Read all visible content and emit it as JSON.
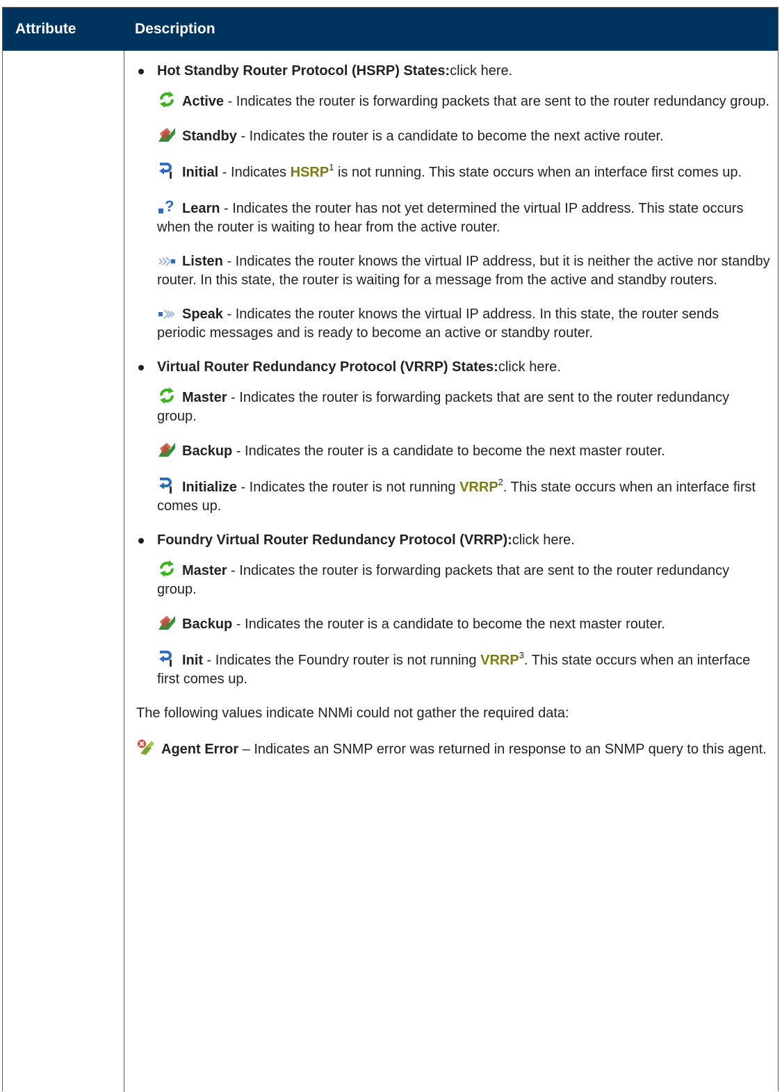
{
  "header": {
    "col_attribute": "Attribute",
    "col_description": "Description"
  },
  "groups": [
    {
      "title": "Hot Standby Router Protocol (HSRP) States:",
      "suffix": "click here.",
      "states": [
        {
          "icon": "active-cycle-icon",
          "name": "Active",
          "text": " - Indicates the router is forwarding packets that are sent to the router redundancy group."
        },
        {
          "icon": "standby-icon",
          "name": "Standby",
          "text": " - Indicates the router is a candidate to become the next active router."
        },
        {
          "icon": "initial-icon",
          "name": "Initial",
          "pre": " - Indicates ",
          "link": "HSRP",
          "sup": "1",
          "post": " is not running. This state occurs when an interface first comes up."
        },
        {
          "icon": "learn-icon",
          "name": "Learn",
          "text": " - Indicates the router has not yet determined the virtual IP address. This state occurs when the router is waiting to hear from the active router."
        },
        {
          "icon": "listen-icon",
          "name": "Listen",
          "text": " - Indicates the router knows the virtual IP address, but it is neither the active nor standby router. In this state, the router is waiting for a message from the active and standby routers."
        },
        {
          "icon": "speak-icon",
          "name": "Speak",
          "text": " - Indicates the router knows the virtual IP address. In this state, the router sends periodic messages and is ready to become an active or standby router."
        }
      ]
    },
    {
      "title": "Virtual Router Redundancy Protocol (VRRP) States:",
      "suffix": "click here.",
      "states": [
        {
          "icon": "active-cycle-icon",
          "name": "Master",
          "text": " - Indicates the router is forwarding packets that are sent to the router redundancy group."
        },
        {
          "icon": "standby-icon",
          "name": "Backup",
          "text": " - Indicates the router is a candidate to become the next master router."
        },
        {
          "icon": "initial-icon",
          "name": "Initialize",
          "pre": " - Indicates the router is not running ",
          "link": "VRRP",
          "sup": "2",
          "post": ". This state occurs when an interface first comes up."
        }
      ]
    },
    {
      "title": "Foundry Virtual Router Redundancy Protocol (VRRP):",
      "suffix": "click here.",
      "states": [
        {
          "icon": "active-cycle-icon",
          "name": "Master",
          "text": " - Indicates the router is forwarding packets that are sent to the router redundancy group."
        },
        {
          "icon": "standby-icon",
          "name": "Backup",
          "text": " - Indicates the router is a candidate to become the next master router."
        },
        {
          "icon": "initial-icon",
          "name": "Init",
          "pre": " - Indicates the Foundry router is not running ",
          "link": "VRRP",
          "sup": "3",
          "post": ". This state occurs when an interface first comes up."
        }
      ]
    }
  ],
  "note": "The following values indicate NNMi could not gather the required data:",
  "agent_error": {
    "icon": "agent-error-icon",
    "name": "Agent Error",
    "text": " – Indicates an SNMP error was returned in response to an SNMP query to this agent."
  }
}
